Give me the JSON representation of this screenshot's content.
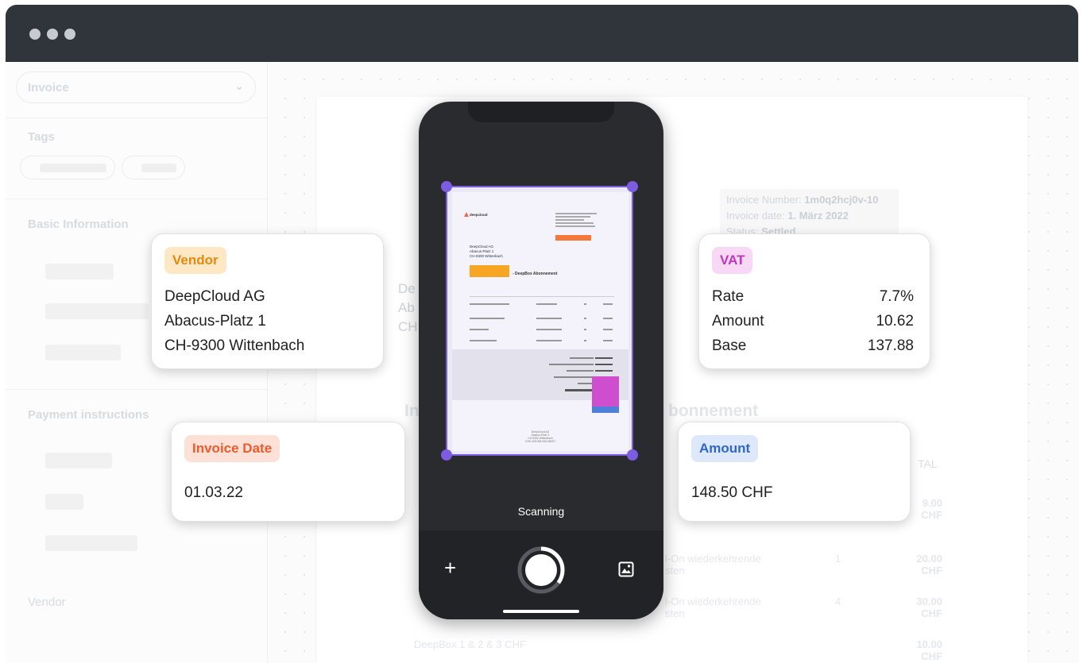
{
  "background": {
    "sidebar": {
      "document_type": "Invoice",
      "tags_heading": "Tags",
      "basic_info_heading": "Basic Information",
      "payment_heading": "Payment instructions",
      "vendor_heading": "Vendor"
    },
    "invoice": {
      "number_label": "Invoice Number:",
      "number_value": "1m0q2hcj0v-10",
      "date_label": "Invoice date:",
      "date_value": "1. März 2022",
      "status_label": "Status:",
      "status_value": "Settled",
      "title_left": "In",
      "title_right": "bonnement",
      "addr_lines": [
        "De",
        "Ab",
        "CH"
      ],
      "col_total": "TAL",
      "rows": [
        {
          "desc": "",
          "qty": "",
          "price": "9.00 CHF"
        },
        {
          "desc": "l-On wiederkehrende\nsten",
          "qty": "1",
          "price": "20.00 CHF"
        },
        {
          "desc": "l-On wiederkehrende\nsten",
          "qty": "4",
          "price": "30.00 CHF"
        },
        {
          "desc": "DeepBox 1 & 2 & 3 CHF",
          "qty": "",
          "price": "10.00 CHF"
        }
      ]
    }
  },
  "phone": {
    "scan_status": "Scanning",
    "scan_progress": 0.35,
    "doc": {
      "logo": "deepcloud",
      "title_highlight": "Invoice / Vendor",
      "title": "- DeepBox Abonnement",
      "address": [
        "DeepCloud AG",
        "Abacus-Platz 1",
        "CH-9300 Wittenbach"
      ],
      "footer": [
        "DeepCloud AG",
        "Abacus-Platz 1",
        "CH-9300 Wittenbach",
        "CHE-409.096.546 MWST"
      ]
    },
    "icons": {
      "add": "plus-icon",
      "shutter": "shutter-icon",
      "gallery": "image-icon"
    }
  },
  "cards": {
    "vendor": {
      "badge": "Vendor",
      "lines": [
        "DeepCloud AG",
        "Abacus-Platz 1",
        "CH-9300 Wittenbach"
      ],
      "badge_bg": "#fde7c4",
      "badge_fg": "#e58a0e"
    },
    "vat": {
      "badge": "VAT",
      "rows": [
        {
          "label": "Rate",
          "value": "7.7%"
        },
        {
          "label": "Amount",
          "value": "10.62"
        },
        {
          "label": "Base",
          "value": "137.88"
        }
      ],
      "badge_bg": "#f8d9f5",
      "badge_fg": "#c235bf"
    },
    "invoice_date": {
      "badge": "Invoice Date",
      "value": "01.03.22",
      "badge_bg": "#fde0d6",
      "badge_fg": "#ea5b2d"
    },
    "amount": {
      "badge": "Amount",
      "value": "148.50 CHF",
      "badge_bg": "#dde8fb",
      "badge_fg": "#2f67c9"
    }
  }
}
